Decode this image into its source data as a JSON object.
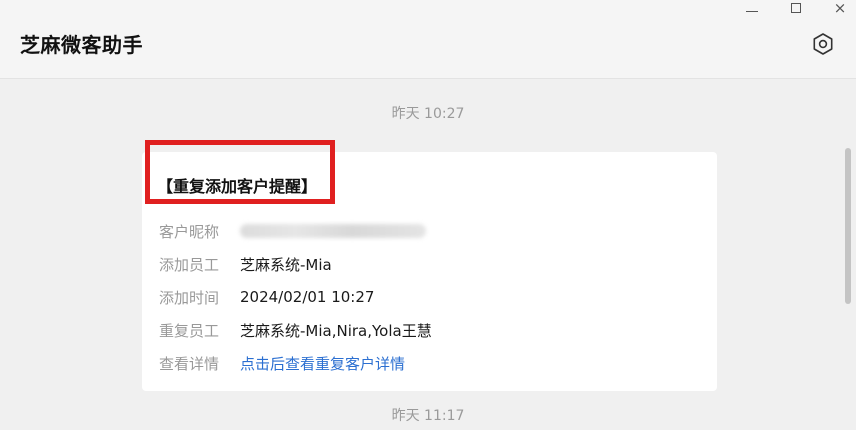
{
  "app": {
    "title": "芝麻微客助手"
  },
  "window_controls": {
    "minimize": "minimize-icon",
    "maximize": "maximize-icon",
    "close": "×"
  },
  "chat": {
    "timestamp_1": "昨天 10:27",
    "timestamp_2": "昨天 11:17",
    "card": {
      "title": "【重复添加客户提醒】",
      "rows": [
        {
          "label": "客户昵称",
          "value": ""
        },
        {
          "label": "添加员工",
          "value": "芝麻系统-Mia"
        },
        {
          "label": "添加时间",
          "value": "2024/02/01 10:27"
        },
        {
          "label": "重复员工",
          "value": "芝麻系统-Mia,Nira,Yola王慧"
        },
        {
          "label": "查看详情",
          "value": "点击后查看重复客户详情"
        }
      ]
    }
  },
  "colors": {
    "accent_link": "#2b6fd1",
    "highlight_box": "#e02020"
  }
}
